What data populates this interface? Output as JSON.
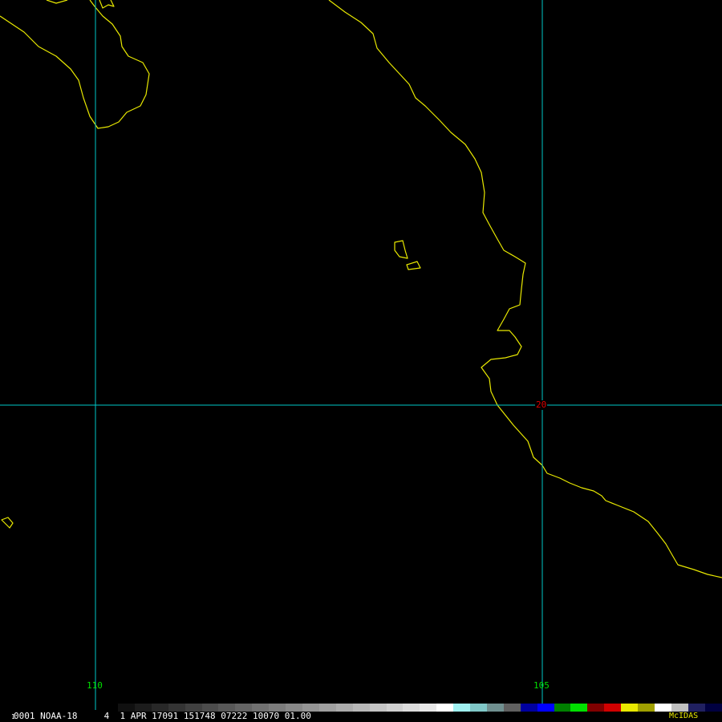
{
  "map": {
    "meridian_labels": [
      "110",
      "105"
    ],
    "parallel_labels": [
      "20"
    ],
    "colors": {
      "background": "#000000",
      "coastline": "#e8e800",
      "gridline": "#00c8c8",
      "meridian_label": "#00e000",
      "parallel_label": "#e00000"
    }
  },
  "status": {
    "frame_digit": "1",
    "text": "0001 NOAA-18     4  1 APR 17091 151748 07222 10070 01.00",
    "brand": "McIDAS"
  },
  "colorbar": {
    "colors": [
      "#101010",
      "#1c1c1c",
      "#282828",
      "#343434",
      "#404040",
      "#4c4c4c",
      "#585858",
      "#646464",
      "#707070",
      "#7c7c7c",
      "#888888",
      "#949494",
      "#a0a0a0",
      "#acacac",
      "#b8b8b8",
      "#c4c4c4",
      "#d0d0d0",
      "#dcdcdc",
      "#e8e8e8",
      "#ffffff",
      "#a0f0f0",
      "#80c8c8",
      "#709090",
      "#606060",
      "#0000a0",
      "#0000ff",
      "#008000",
      "#00e000",
      "#800000",
      "#d00000",
      "#e8e800",
      "#a0a000",
      "#ffffff",
      "#c0c0c0",
      "#202060",
      "#000040"
    ]
  }
}
